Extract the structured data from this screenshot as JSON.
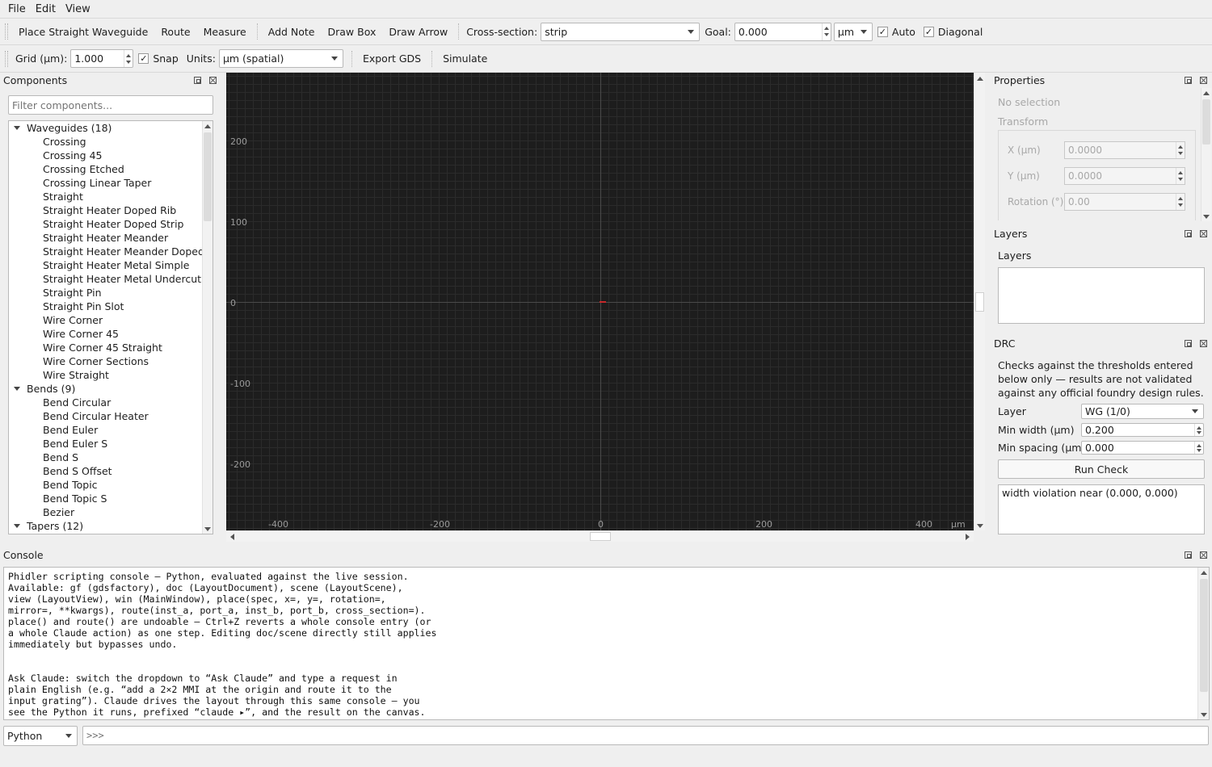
{
  "menu": [
    "File",
    "Edit",
    "View"
  ],
  "toolbar1": {
    "tools": [
      "Place Straight Waveguide",
      "Route",
      "Measure"
    ],
    "annot": [
      "Add Note",
      "Draw Box",
      "Draw Arrow"
    ],
    "cross_section_label": "Cross-section:",
    "cross_section_value": "strip",
    "goal_label": "Goal:",
    "goal_value": "0.000",
    "unit_value": "µm",
    "auto_label": "Auto",
    "diagonal_label": "Diagonal"
  },
  "toolbar2": {
    "grid_label": "Grid (µm):",
    "grid_value": "1.000",
    "snap_label": "Snap",
    "units_label": "Units:",
    "units_value": "µm  (spatial)",
    "export_label": "Export GDS",
    "simulate_label": "Simulate"
  },
  "components": {
    "title": "Components",
    "filter_placeholder": "Filter components...",
    "groups": [
      {
        "label": "Waveguides (18)",
        "items": [
          "Crossing",
          "Crossing 45",
          "Crossing Etched",
          "Crossing Linear Taper",
          "Straight",
          "Straight Heater Doped Rib",
          "Straight Heater Doped Strip",
          "Straight Heater Meander",
          "Straight Heater Meander Doped",
          "Straight Heater Metal Simple",
          "Straight Heater Metal Undercut",
          "Straight Pin",
          "Straight Pin Slot",
          "Wire Corner",
          "Wire Corner 45",
          "Wire Corner 45 Straight",
          "Wire Corner Sections",
          "Wire Straight"
        ]
      },
      {
        "label": "Bends (9)",
        "items": [
          "Bend Circular",
          "Bend Circular Heater",
          "Bend Euler",
          "Bend Euler S",
          "Bend S",
          "Bend S Offset",
          "Bend Topic",
          "Bend Topic S",
          "Bezier"
        ]
      },
      {
        "label": "Tapers (12)",
        "items": []
      }
    ]
  },
  "canvas": {
    "y_labels": [
      "200",
      "100",
      "0",
      "-100",
      "-200"
    ],
    "x_labels": [
      "-400",
      "-200",
      "0",
      "200",
      "400"
    ],
    "unit": "µm"
  },
  "properties": {
    "title": "Properties",
    "no_selection": "No selection",
    "transform_label": "Transform",
    "x_label": "X (µm)",
    "x_value": "0.0000",
    "y_label": "Y (µm)",
    "y_value": "0.0000",
    "rot_label": "Rotation (°)",
    "rot_value": "0.00"
  },
  "layers": {
    "title": "Layers",
    "subtitle": "Layers"
  },
  "drc": {
    "title": "DRC",
    "description": "Checks against the thresholds entered below only — results are not validated against any official foundry design rules.",
    "layer_label": "Layer",
    "layer_value": "WG (1/0)",
    "min_width_label": "Min width (µm)",
    "min_width_value": "0.200",
    "min_spacing_label": "Min spacing (µm)",
    "min_spacing_value": "0.000",
    "run_label": "Run Check",
    "result": "width violation near (0.000, 0.000)"
  },
  "console": {
    "title": "Console",
    "text": "Phidler scripting console — Python, evaluated against the live session.\nAvailable: gf (gdsfactory), doc (LayoutDocument), scene (LayoutScene),\nview (LayoutView), win (MainWindow), place(spec, x=, y=, rotation=,\nmirror=, **kwargs), route(inst_a, port_a, inst_b, port_b, cross_section=).\nplace() and route() are undoable — Ctrl+Z reverts a whole console entry (or\na whole Claude action) as one step. Editing doc/scene directly still applies\nimmediately but bypasses undo.\n\n\nAsk Claude: switch the dropdown to “Ask Claude” and type a request in\nplain English (e.g. “add a 2×2 MMI at the origin and route it to the\ninput grating”). Claude drives the layout through this same console — you\nsee the Python it runs, prefixed “claude ▸”, and the result on the canvas.",
    "mode_value": "Python",
    "input_placeholder": ">>>"
  }
}
